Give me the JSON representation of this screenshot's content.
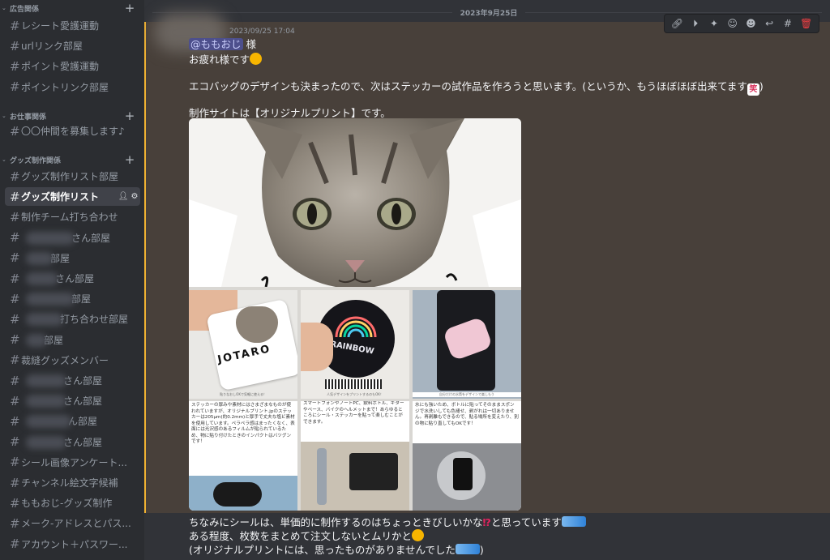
{
  "sidebar": {
    "categories": [
      {
        "label": "広告関係",
        "channels": [
          "レシート愛護運動",
          "urlリンク部屋",
          "ポイント愛護運動",
          "ポイントリンク部屋"
        ]
      },
      {
        "label": "お仕事関係",
        "channels": [
          "〇〇仲間を募集します♪"
        ]
      },
      {
        "label": "グッズ制作関係",
        "channels": [
          "グッズ制作リスト部屋",
          "グッズ制作リスト",
          "制作チーム打ち合わせ",
          "さん部屋",
          "部屋",
          "さん部屋",
          "部屋",
          "打ち合わせ部屋",
          "部屋",
          "裁縫グッズメンバー",
          "さん部屋",
          "さん部屋",
          "ん部屋",
          "さん部屋",
          "シール画像アンケート...",
          "チャンネル絵文字候補",
          "ももおじ-グッズ制作",
          "メーク-アドレスとパス...",
          "アカウント＋パスワー..."
        ]
      }
    ],
    "active_channel": "グッズ制作リスト",
    "add_icon": "plus-icon",
    "hash_glyph": "#"
  },
  "main": {
    "date_divider": "2023年9月25日",
    "timestamp": "2023/09/25 17:04",
    "toolbar_icons": [
      "link-icon",
      "tag-icon",
      "pin-icon",
      "add-reaction-icon",
      "reaction-icon",
      "reply-icon",
      "thread-icon",
      "delete-icon"
    ],
    "message": {
      "mention": "@ももおじ",
      "honorific": " 様",
      "line2": "お疲れ様です",
      "line3_a": "エコバッグのデザインも決まったので、次はステッカーの試作品を作ろうと思います。(というか、もうほぼほぼ出来てます",
      "line3_b": ")",
      "laugh_emoji": "笑",
      "line4": "制作サイトは【オリジナルプリント】です。",
      "line5_a": "ちなみにシールは、単価的に制作するのはちょっときびしいかな",
      "line5_excl": "⁉",
      "line5_b": "と思っています",
      "line6": "ある程度、枚数をまとめて注文しないとムリかと",
      "line7_a": "(オリジナルプリントには、思ったものがありませんでした",
      "line7_b": ")"
    },
    "image": {
      "sticker_texts": [
        "JOTARO",
        "RAINBOW"
      ],
      "small_captions": [
        "貼りなおしOKで気軽に使える！",
        "人気デザインをプリントするのもOK！",
        "自分だけの水筒をデザインで楽しもう"
      ],
      "captions": [
        "ステッカーの厚みや素材にはさまざまなものが使われていますが、オリジナルプリント.jpのステッカーは205μm(約0.2mm)と厚手で丈夫な塩ビ素材を使用しています。ペラペラ感はまったくなく、表面には光沢感のあるフィルムが貼られているため、物に貼り付けたときのインパクトはバツグンです！",
        "スマートフォンやノートPC、飲料ボトル、ギターやベース、バイクのヘルメットまで！あらゆるところにシール・ステッカーを貼って楽しむことができます。",
        "水にも強いため、ボトルに貼ってそのままスポンジで水洗いしても色褪せ、剥がれは一切ありません。再剥離もできるので、貼る場所を変えたり、別の物に貼り直してもOKです！"
      ]
    }
  },
  "colors": {
    "accent_border": "#f0b232",
    "highlight_bg": "#48403a",
    "mention_bg": "#4d4f8c",
    "danger": "#f23f43"
  }
}
